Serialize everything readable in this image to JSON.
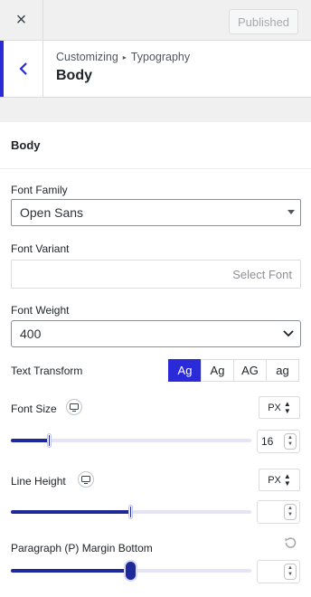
{
  "header": {
    "close_label": "×",
    "publish_label": "Published"
  },
  "section": {
    "breadcrumb_parent": "Customizing",
    "breadcrumb_separator": "▸",
    "breadcrumb_current": "Typography",
    "title": "Body"
  },
  "panel": {
    "title": "Body",
    "font_family": {
      "label": "Font Family",
      "value": "Open Sans"
    },
    "font_variant": {
      "label": "Font Variant",
      "placeholder": "Select Font"
    },
    "font_weight": {
      "label": "Font Weight",
      "value": "400"
    },
    "text_transform": {
      "label": "Text Transform",
      "options": [
        "Ag",
        "Ag",
        "AG",
        "ag"
      ],
      "selected_index": 0
    },
    "font_size": {
      "label": "Font Size",
      "unit": "PX",
      "value": "16",
      "slider_fraction": 0.16
    },
    "line_height": {
      "label": "Line Height",
      "unit": "PX",
      "value": "",
      "slider_fraction": 0.5
    },
    "margin_bottom": {
      "label": "Paragraph (P) Margin Bottom",
      "value": "",
      "slider_fraction": 0.5
    }
  },
  "colors": {
    "accent": "#2a2ad8",
    "slider_fill": "#1e2a9a",
    "slider_track": "#e4e4f4"
  },
  "icons": {
    "close": "close-icon",
    "back": "chevron-left-icon",
    "device": "desktop-icon",
    "reset": "reset-icon"
  }
}
